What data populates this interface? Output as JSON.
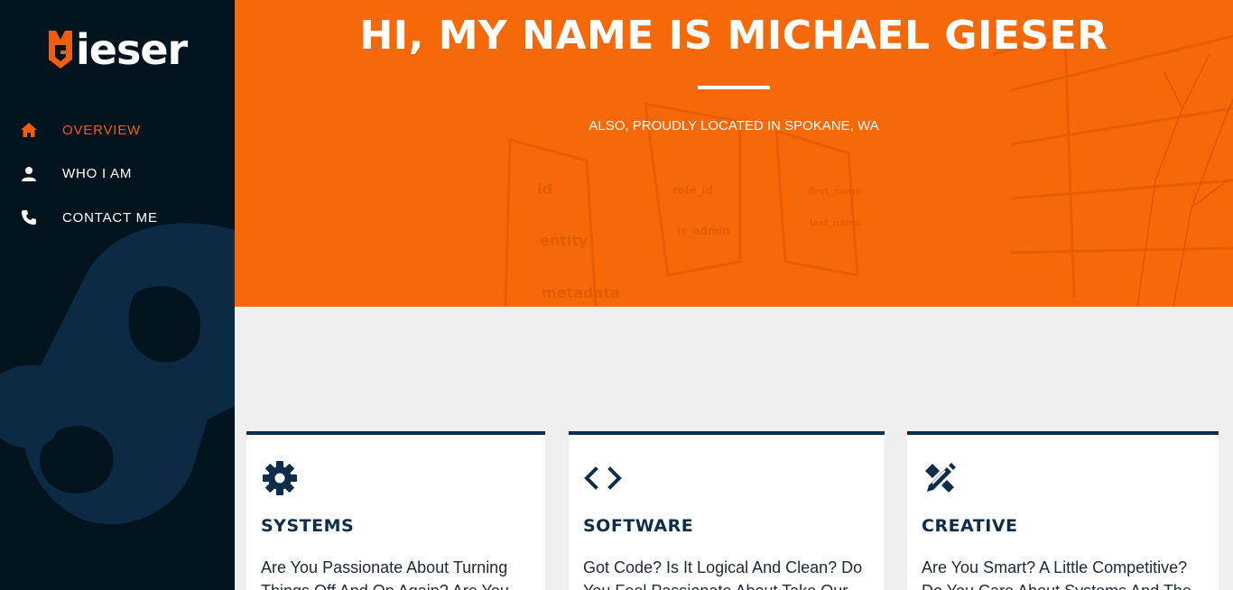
{
  "brand": {
    "logo_mark": "MG",
    "logo_text": "ieser"
  },
  "sidebar": {
    "items": [
      {
        "label": "OVERVIEW",
        "icon": "home-icon",
        "active": true
      },
      {
        "label": "WHO I AM",
        "icon": "person-icon",
        "active": false
      },
      {
        "label": "CONTACT ME",
        "icon": "phone-icon",
        "active": false
      }
    ]
  },
  "hero": {
    "title": "HI, MY NAME IS MICHAEL GIESER",
    "subtitle": "ALSO, PROUDLY LOCATED IN SPOKANE, WA",
    "background_words": [
      "id",
      "entity",
      "metadata",
      "role_id",
      "is_admin",
      "first_name",
      "last_name"
    ]
  },
  "cards": [
    {
      "icon": "gear-icon",
      "title": "SYSTEMS",
      "text": "Are You Passionate About Turning Things Off And On Again? Are You"
    },
    {
      "icon": "code-icon",
      "title": "SOFTWARE",
      "text": "Got Code? Is It Logical And Clean? Do You Feel Passionate About Take Our"
    },
    {
      "icon": "pencil-ruler-icon",
      "title": "CREATIVE",
      "text": "Are You Smart? A Little Competitive? Do You Care About Systems And The"
    }
  ],
  "colors": {
    "accent": "#f25e0e",
    "sidebar_bg": "#03141f",
    "hero_bg": "#f76808",
    "navy": "#0e2d48",
    "page_bg": "#efefef"
  }
}
